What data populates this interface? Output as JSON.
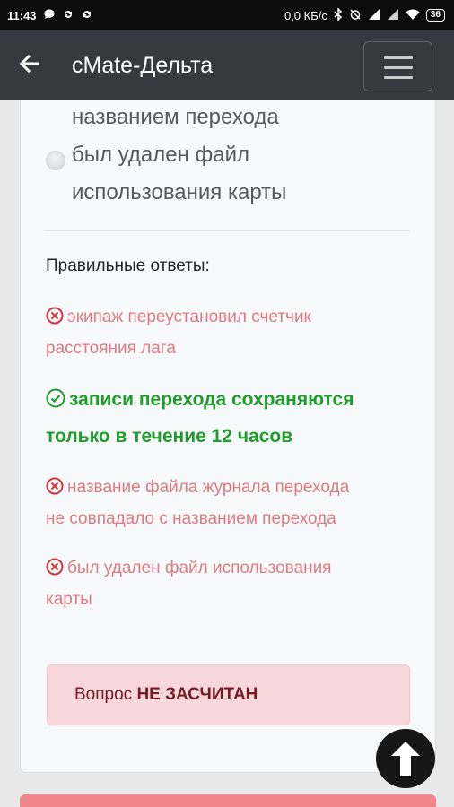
{
  "status_bar": {
    "time": "11:43",
    "network_speed": "0,0 КБ/с",
    "battery": "36",
    "icons": [
      "chat-icon",
      "sync-icon",
      "sync-icon",
      "bluetooth-icon",
      "alarm-off-icon",
      "signal-icon",
      "signal-icon",
      "wifi-icon",
      "battery-icon"
    ]
  },
  "app_bar": {
    "title": "cMate-Дельта",
    "icons": [
      "back-arrow-icon",
      "menu-icon"
    ]
  },
  "question": {
    "option_partial_line": "названием перехода",
    "last_option_line1": "был удален файл",
    "last_option_line2": "использования карты"
  },
  "results": {
    "correct_label": "Правильные ответы:",
    "answers": [
      {
        "status": "wrong",
        "icon": "x-circle-icon",
        "line1": "экипаж переустановил счетчик",
        "line2": "расстояния лага"
      },
      {
        "status": "correct",
        "icon": "check-circle-icon",
        "line1": "записи перехода сохраняются",
        "line2": "только в течение 12 часов"
      },
      {
        "status": "wrong",
        "icon": "x-circle-icon",
        "line1": "название файла журнала перехода",
        "line2": "не совпадало с названием перехода"
      },
      {
        "status": "wrong",
        "icon": "x-circle-icon",
        "line1": "был удален файл использования",
        "line2": "карты"
      }
    ],
    "verdict_prefix": "Вопрос",
    "verdict_status": "НЕ ЗАСЧИТАН"
  },
  "colors": {
    "app_bar": "#343a40",
    "wrong": "#dc7b84",
    "correct": "#1f9d2c",
    "alert_bg": "#f8d7da",
    "alert_text": "#721c24"
  },
  "scroll_top_icon": "arrow-up-icon"
}
